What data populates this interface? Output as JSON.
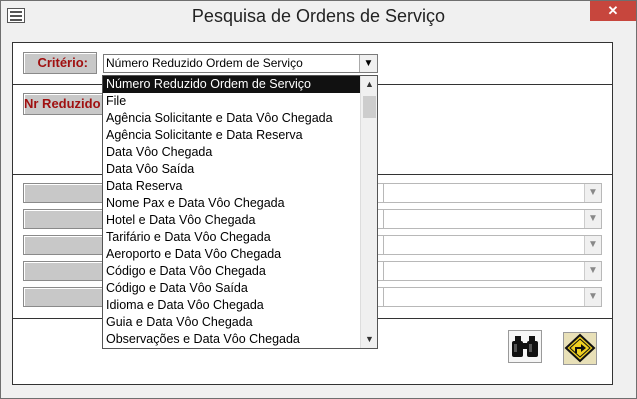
{
  "window": {
    "title": "Pesquisa de Ordens de Serviço",
    "close_glyph": "✕"
  },
  "criterio": {
    "label": "Critério:",
    "value": "Número Reduzido Ordem de Serviço"
  },
  "nr_label": "Nr Reduzido",
  "dropdown": {
    "options": [
      "Número Reduzido Ordem de Serviço",
      "File",
      "Agência Solicitante e Data Vôo Chegada",
      "Agência Solicitante e Data Reserva",
      "Data Vôo Chegada",
      "Data Vôo Saída",
      "Data Reserva",
      "Nome Pax e Data Vôo Chegada",
      "Hotel e Data Vôo Chegada",
      "Tarifário e Data Vôo Chegada",
      "Aeroporto e Data Vôo Chegada",
      "Código e Data Vôo Chegada",
      "Código e Data Vôo Saída",
      "Idioma e Data Vôo Chegada",
      "Guia e Data Vôo Chegada",
      "Observações e Data Vôo Chegada"
    ]
  },
  "icons": {
    "window": "form-icon",
    "search": "binoculars-icon",
    "exit": "exit-sign-icon",
    "dropdown": "chevron-down-icon"
  }
}
